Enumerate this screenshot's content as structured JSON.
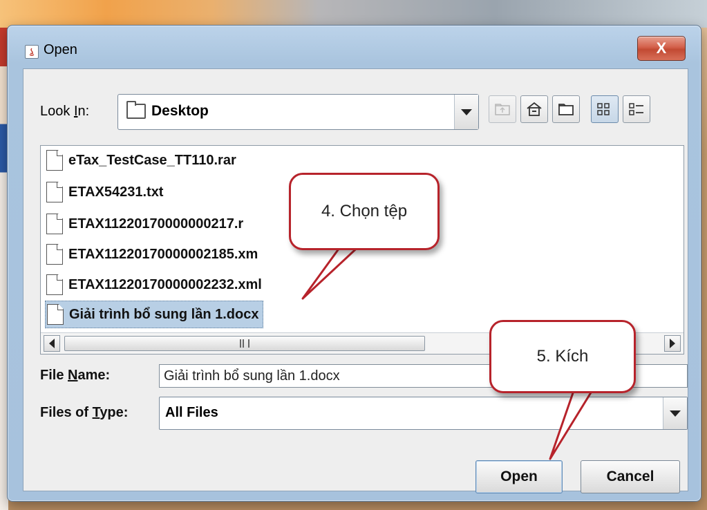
{
  "window": {
    "title": "Open",
    "close_label": "X"
  },
  "look_in": {
    "label_pre": "Look ",
    "label_u": "I",
    "label_post": "n:",
    "value": "Desktop"
  },
  "toolbar": {
    "icons": [
      "up-folder-icon",
      "home-icon",
      "new-folder-icon",
      "list-view-icon",
      "details-view-icon"
    ]
  },
  "files": [
    {
      "name": "eTax_TestCase_TT110.rar",
      "selected": false
    },
    {
      "name": "ETAX54231.txt",
      "selected": false
    },
    {
      "name": "ETAX11220170000000217.r",
      "selected": false
    },
    {
      "name": "ETAX11220170000002185.xm",
      "selected": false
    },
    {
      "name": "ETAX11220170000002232.xml",
      "selected": false
    },
    {
      "name": "Giải trình bổ sung lần 1.docx",
      "selected": true
    }
  ],
  "file_name": {
    "label_pre": "File ",
    "label_u": "N",
    "label_post": "ame:",
    "value": "Giải trình bổ sung lần 1.docx"
  },
  "file_type": {
    "label_pre": "Files of ",
    "label_u": "T",
    "label_post": "ype:",
    "value": "All Files"
  },
  "buttons": {
    "open": "Open",
    "cancel": "Cancel"
  },
  "annotations": {
    "step4": "4. Chọn tệp",
    "step5": "5. Kích"
  },
  "colors": {
    "callout_border": "#b7232b",
    "selection": "#b8cfe5",
    "close_button": "#c24a33"
  }
}
